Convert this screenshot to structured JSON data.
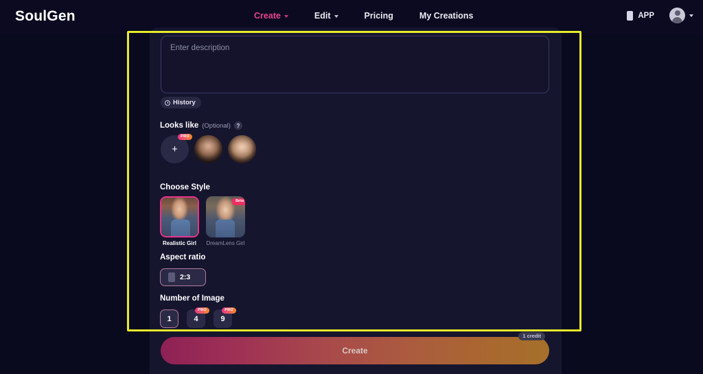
{
  "header": {
    "logo": "SoulGen",
    "nav": [
      {
        "label": "Create",
        "has_caret": true,
        "active": true
      },
      {
        "label": "Edit",
        "has_caret": true,
        "active": false
      },
      {
        "label": "Pricing",
        "has_caret": false,
        "active": false
      },
      {
        "label": "My Creations",
        "has_caret": false,
        "active": false
      }
    ],
    "app_label": "APP"
  },
  "description": {
    "placeholder": "Enter description",
    "value": ""
  },
  "history": {
    "label": "History"
  },
  "looks_like": {
    "label": "Looks like",
    "optional": "(Optional)",
    "help": "?",
    "add_label": "+",
    "add_badge": "PRO",
    "faces": [
      "face-thumbnail-1",
      "face-thumbnail-2"
    ]
  },
  "choose_style": {
    "label": "Choose Style",
    "options": [
      {
        "name": "Realistic Girl",
        "selected": true,
        "badge": ""
      },
      {
        "name": "DreamLens Girl",
        "selected": false,
        "badge": "Beta"
      }
    ]
  },
  "aspect_ratio": {
    "label": "Aspect ratio",
    "options": [
      {
        "value": "2:3",
        "selected": true
      }
    ]
  },
  "number_of_image": {
    "label": "Number of Image",
    "options": [
      {
        "value": "1",
        "selected": true,
        "badge": ""
      },
      {
        "value": "4",
        "selected": false,
        "badge": "PRO"
      },
      {
        "value": "9",
        "selected": false,
        "badge": "PRO"
      }
    ]
  },
  "create": {
    "label": "Create",
    "credit": "1 credit"
  },
  "colors": {
    "page_bg": "#0a0a1e",
    "panel_bg": "#16152e",
    "accent_pink": "#e8348c",
    "highlight": "#e6ec2a",
    "beta": "#ef2f63"
  }
}
